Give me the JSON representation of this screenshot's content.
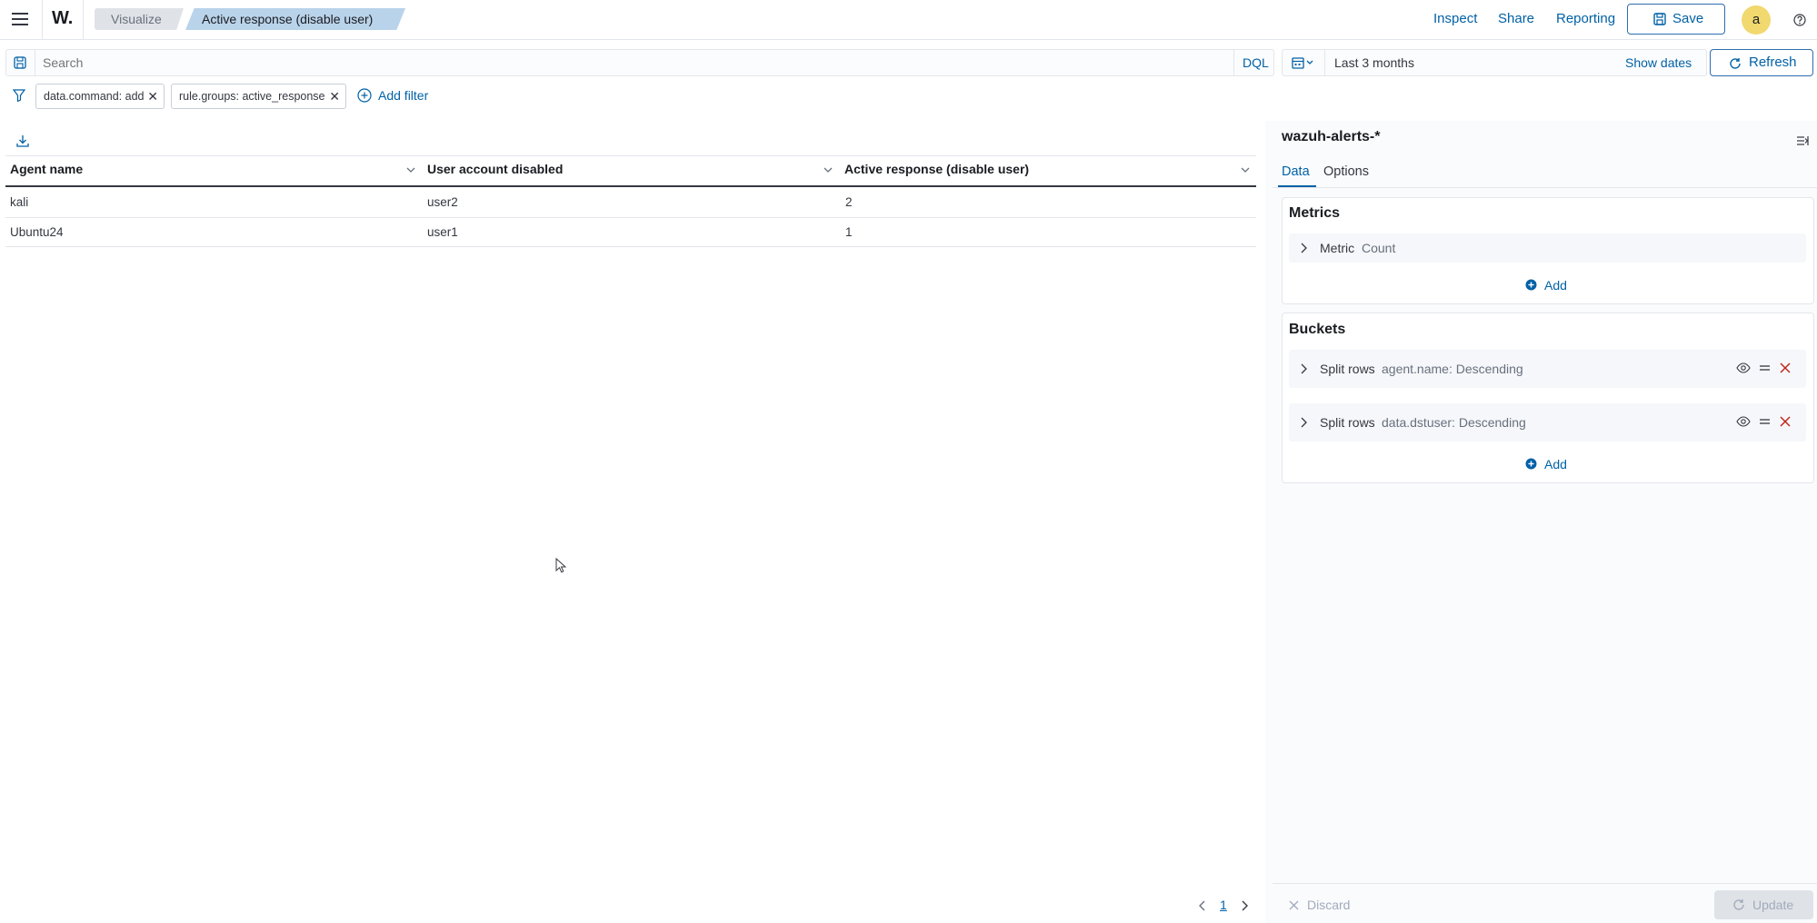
{
  "header": {
    "logo": "W.",
    "breadcrumbs": [
      "Visualize",
      "Active response (disable user)"
    ],
    "links": {
      "inspect": "Inspect",
      "share": "Share",
      "reporting": "Reporting"
    },
    "save_label": "Save",
    "avatar_letter": "a"
  },
  "query": {
    "search_placeholder": "Search",
    "language": "DQL",
    "date_range": "Last 3 months",
    "show_dates": "Show dates",
    "refresh": "Refresh"
  },
  "filters": {
    "pills": [
      "data.command: add",
      "rule.groups: active_response"
    ],
    "add_filter": "Add filter"
  },
  "table": {
    "columns": [
      "Agent name",
      "User account disabled",
      "Active response (disable user)"
    ],
    "rows": [
      [
        "kali",
        "user2",
        "2"
      ],
      [
        "Ubuntu24",
        "user1",
        "1"
      ]
    ],
    "page": "1"
  },
  "panel": {
    "index_pattern": "wazuh-alerts-*",
    "tabs": [
      "Data",
      "Options"
    ],
    "metrics_title": "Metrics",
    "metric": {
      "label": "Metric",
      "value": "Count"
    },
    "add_label": "Add",
    "buckets_title": "Buckets",
    "buckets": [
      {
        "label": "Split rows",
        "value": "agent.name: Descending"
      },
      {
        "label": "Split rows",
        "value": "data.dstuser: Descending"
      }
    ],
    "discard": "Discard",
    "update": "Update"
  },
  "colors": {
    "accent": "#0061a6",
    "danger": "#bd271e",
    "breadcrumb_active": "#b9d3ea"
  }
}
